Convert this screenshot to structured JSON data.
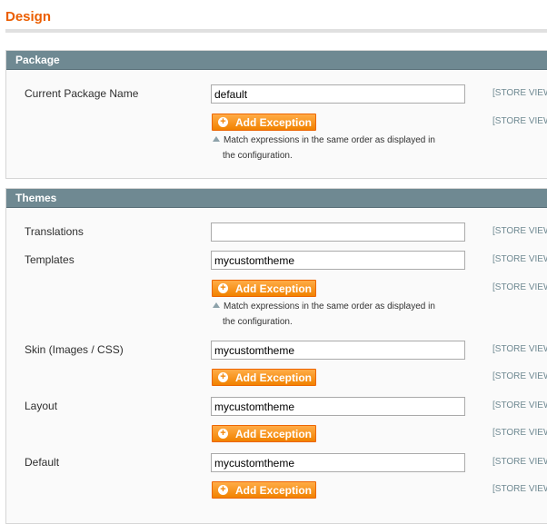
{
  "page": {
    "title": "Design"
  },
  "sections": {
    "package": {
      "header": "Package",
      "current_package_name": {
        "label": "Current Package Name",
        "value": "default"
      }
    },
    "themes": {
      "header": "Themes",
      "translations": {
        "label": "Translations",
        "value": ""
      },
      "templates": {
        "label": "Templates",
        "value": "mycustomtheme"
      },
      "skin": {
        "label": "Skin (Images / CSS)",
        "value": "mycustomtheme"
      },
      "layout": {
        "label": "Layout",
        "value": "mycustomtheme"
      },
      "default": {
        "label": "Default",
        "value": "mycustomtheme"
      }
    }
  },
  "common": {
    "scope_label": "[STORE VIEW]",
    "add_exception_label": "Add Exception",
    "note_line1": "Match expressions in the same order as displayed in",
    "note_line2": "the configuration."
  },
  "colors": {
    "title": "#eb5e00",
    "section_header": "#6f8992",
    "button": "#f18200",
    "scope": "#6f8992"
  },
  "icons": {
    "button_icon": "plus-circle-icon",
    "note_icon": "triangle-up-icon"
  }
}
